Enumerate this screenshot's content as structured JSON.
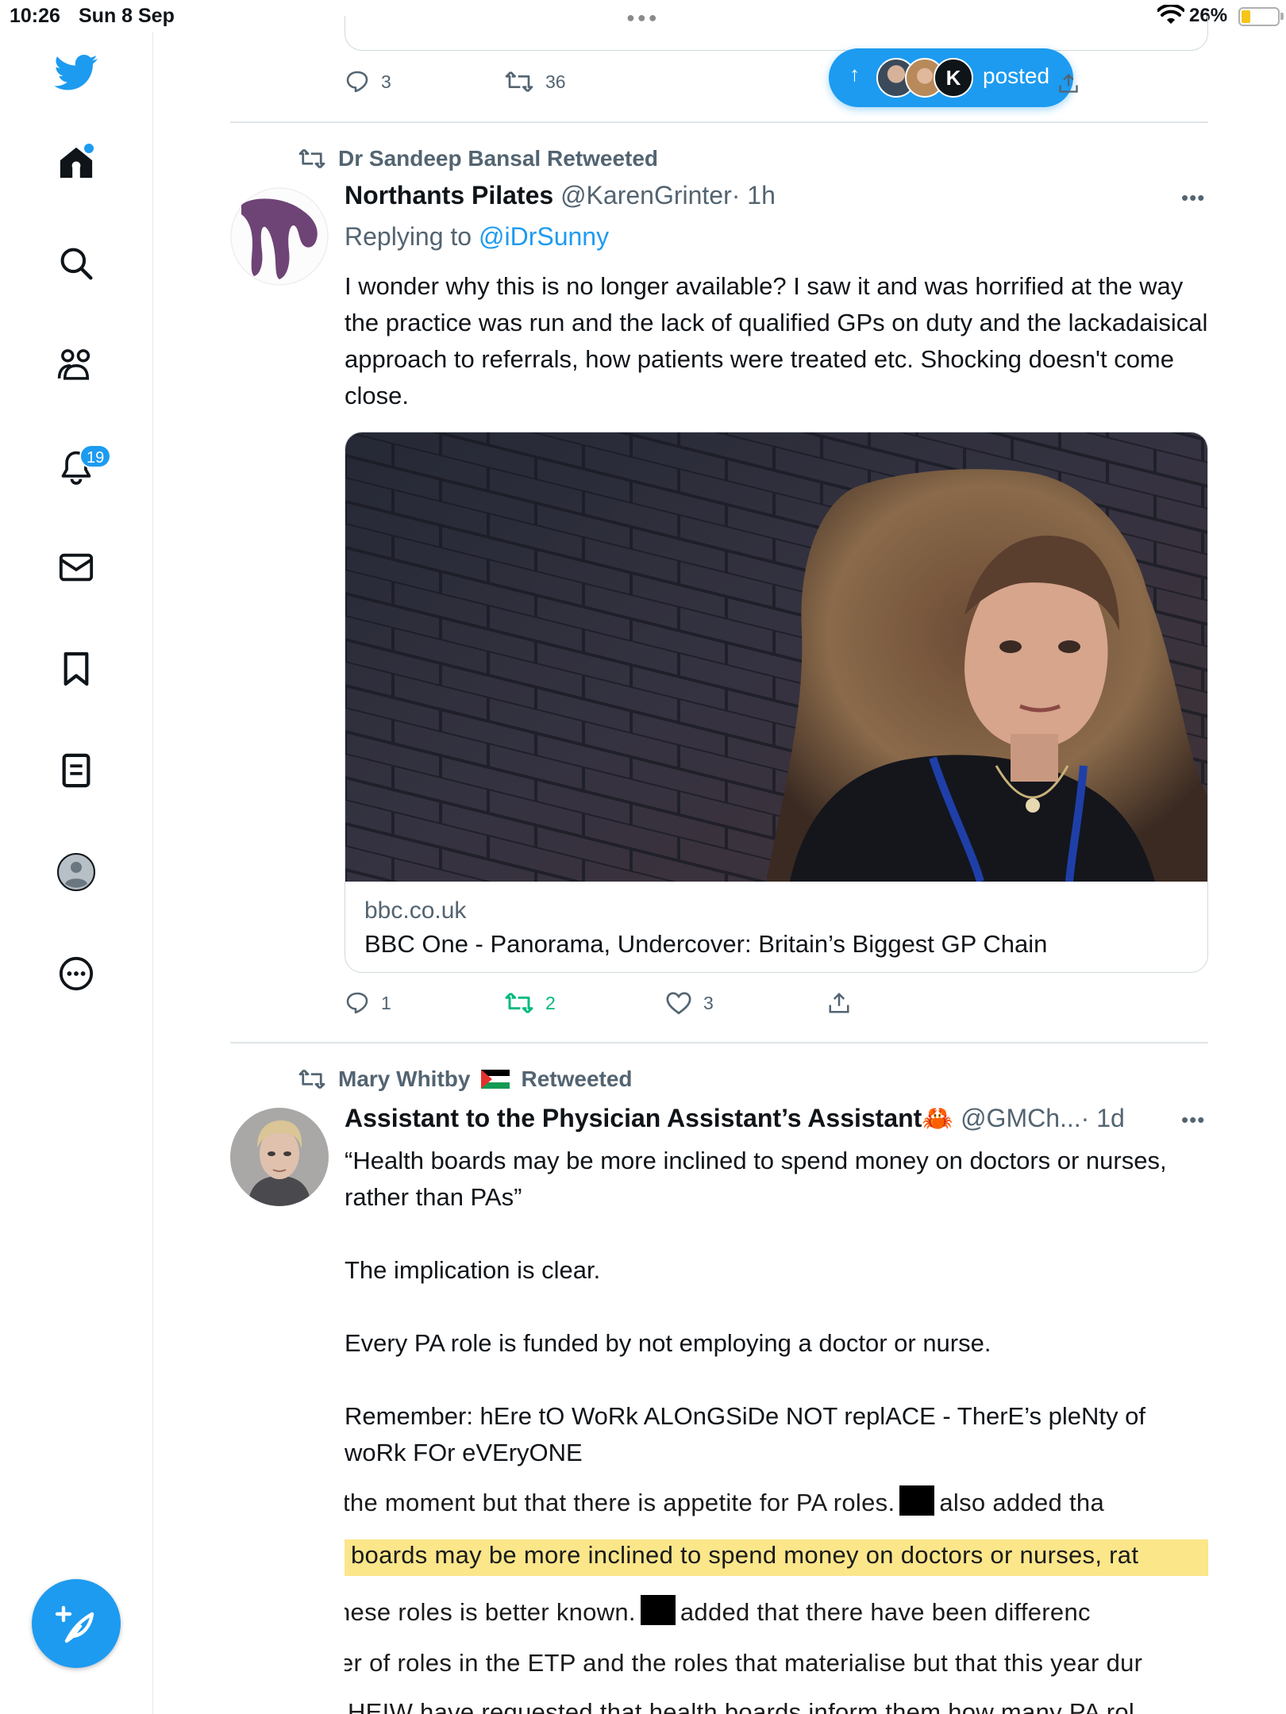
{
  "status_bar": {
    "time": "10:26",
    "date": "Sun 8 Sep",
    "battery_percent": "26%",
    "battery_level": 0.26
  },
  "sidebar": {
    "home_has_new": true,
    "notifications_count": "19",
    "items": [
      "twitter-logo",
      "home",
      "explore",
      "communities",
      "notifications",
      "messages",
      "bookmarks",
      "lists",
      "profile",
      "more"
    ]
  },
  "feed": {
    "prev_tweet": {
      "replies": "3",
      "retweets": "36"
    },
    "posted_pill": {
      "label": "posted",
      "third_avatar_initial": "K"
    },
    "tweet1": {
      "retweeted_by": "Dr Sandeep Bansal Retweeted",
      "name": "Northants Pilates",
      "handle": "@KarenGrinter",
      "time": "· 1h",
      "replying_prefix": "Replying to",
      "replying_to": "@iDrSunny",
      "text": "I wonder why this is no longer available? I saw it and was horrified at the way the practice was run and the lack of qualified GPs on duty and the lackadaisical approach to referrals, how patients were treated etc. Shocking doesn't come close.",
      "card_domain": "bbc.co.uk",
      "card_title": "BBC One - Panorama, Undercover: Britain’s Biggest GP Chain",
      "replies": "1",
      "retweets": "2",
      "likes": "3"
    },
    "tweet2": {
      "retweeted_by_name": "Mary Whitby",
      "retweeted_by_suffix": "Retweeted",
      "name": "Assistant to the Physician Assistant’s Assistant",
      "name_emoji": "🦀",
      "handle": "@GMCh...",
      "time": "· 1d",
      "text": "“Health boards may be more inclined to spend money on doctors or nurses, rather than PAs”\n\nThe implication is clear.\n\nEvery PA role is funded by not employing a doctor or nurse.\n\nRemember: hEre tO WoRk ALOnGSiDe NOT replACE - TherE’s pleNty of woRk FOr eVEryONE",
      "doc_lines": [
        "the moment but that there is appetite for PA roles.",
        "also added tha",
        "boards may be more inclined to spend money on doctors or nurses, rat",
        "hese roles is better known.",
        "added that there have been differenc",
        "er of roles in the ETP and the roles that materialise but that this year dur",
        "HEIW have requested that health boards inform them how many PA rol"
      ]
    }
  },
  "colors": {
    "accent": "#1d9bf0",
    "retweet_active": "#00ba7c",
    "secondary_text": "#536471",
    "highlight": "#fbe68a"
  }
}
